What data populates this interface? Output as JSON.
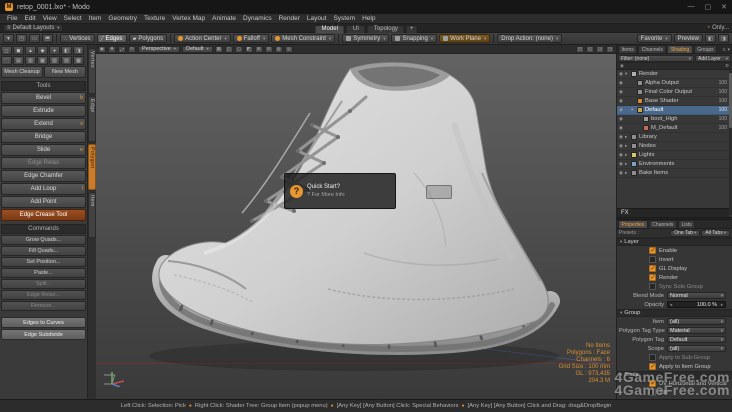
{
  "window": {
    "title": "retop_0001.lxo* - Modo",
    "icon_letter": "M",
    "controls": {
      "minimize": "—",
      "maximize": "▢",
      "close": "✕"
    }
  },
  "glyphs": {
    "caret": "▾",
    "collapse": "▸",
    "expand": "▾",
    "bullet": "●",
    "menu": "≡",
    "clock": "◔",
    "eye": "◉",
    "gear": "⚙",
    "arrow_left": "◂",
    "arrow_right": "▸",
    "tooltip_mark": "?"
  },
  "colors": {
    "accent": "#e8962e",
    "selection": "#49688c"
  },
  "menu_bar": {
    "items": [
      "File",
      "Edit",
      "View",
      "Select",
      "Item",
      "Geometry",
      "Texture",
      "Vertex Map",
      "Animate",
      "Dynamics",
      "Render",
      "Layout",
      "System",
      "Help"
    ]
  },
  "layout_bar": {
    "layouts_label": "Default Layouts",
    "tabs": [
      "Model",
      "UI",
      "Topology"
    ],
    "active_tab": "Model",
    "add_tab": "+",
    "right_label": "Only..."
  },
  "toolbar": {
    "left_icons": [
      "▼",
      "◳",
      "▭",
      "⬒"
    ],
    "selection_modes": [
      {
        "label": "Vertices",
        "icon": "∴",
        "active": false
      },
      {
        "label": "Edges",
        "icon": "╱",
        "active": true
      },
      {
        "label": "Polygons",
        "icon": "▰",
        "active": false
      }
    ],
    "tool_dropdowns": [
      {
        "label": "Action Center"
      },
      {
        "label": "Falloff"
      },
      {
        "label": "Mesh Constraint"
      }
    ],
    "modifiers": [
      {
        "label": "Symmetry",
        "accent": false
      },
      {
        "label": "Snapping",
        "accent": false
      },
      {
        "label": "Work Plane",
        "accent": true
      }
    ],
    "drop_action_label": "Drop Action: (none)",
    "right_buttons": [
      {
        "label": "Favorite",
        "caret": true
      },
      {
        "label": "Preview",
        "caret": false
      }
    ],
    "right_icons": [
      "◧",
      "◨"
    ]
  },
  "viewport_bar": {
    "left_icons": [
      "◉",
      "✥",
      "⤢",
      "⟳"
    ],
    "camera": "Perspective",
    "shading": "Default",
    "mid_icons": [
      "▦",
      "◫",
      "◻",
      "◩",
      "⊞",
      "⊟",
      "◍",
      "◎"
    ],
    "right_icons": [
      "◰",
      "◱",
      "◲",
      "◳"
    ]
  },
  "left_panel": {
    "icon_row1": [
      "◻",
      "◼",
      "▲",
      "◆",
      "●",
      "◧",
      "◨"
    ],
    "icon_row2": [
      "⬚",
      "▤",
      "▥",
      "▦",
      "▧",
      "▨",
      "▩"
    ],
    "top_buttons": [
      {
        "label": "Mesh Cleanup"
      },
      {
        "label": "New Mesh"
      }
    ],
    "tools_header": "Tools",
    "tools": [
      {
        "label": "Bevel",
        "shortcut": "b"
      },
      {
        "label": "Extrude",
        "shortcut": ""
      },
      {
        "label": "Extend",
        "shortcut": "x"
      },
      {
        "label": "Bridge",
        "shortcut": ""
      },
      {
        "label": "Slide",
        "shortcut": "e"
      },
      {
        "label": "Edge Relax",
        "shortcut": "",
        "dim": true
      },
      {
        "label": "Edge Chamfer",
        "shortcut": ""
      },
      {
        "label": "Add Loop",
        "shortcut": "l"
      },
      {
        "label": "Add Point",
        "shortcut": ""
      },
      {
        "label": "Edge Crease Tool",
        "shortcut": "",
        "active": true
      }
    ],
    "commands_header": "Commands",
    "commands": [
      {
        "label": "Grow Quads..."
      },
      {
        "label": "Fill Quads..."
      },
      {
        "label": "Set Position..."
      },
      {
        "label": "Paste..."
      },
      {
        "label": "Split...",
        "dim": true
      },
      {
        "label": "Edge Relax...",
        "dim": true
      },
      {
        "label": "Remove...",
        "dim": true
      }
    ],
    "bottom_buttons": [
      {
        "label": "Edges to Curves"
      },
      {
        "label": "Edge Subdivide"
      }
    ],
    "side_tabs": [
      "Vertex",
      "Edge",
      "Polygon",
      "Item"
    ],
    "side_active": "Polygon"
  },
  "viewport": {
    "tooltip": {
      "line1": "Quick Start?",
      "line2": "? For More Info"
    },
    "stats": [
      "No Items",
      "Polygons : Face",
      "Channels : 6",
      "Grid Size : 100 mm",
      "GL : 973,435",
      "204.3 M"
    ],
    "watermark": "4GameFree.com"
  },
  "shader_panel": {
    "tabs": [
      {
        "label": "Items",
        "active": false
      },
      {
        "label": "Channels",
        "active": false
      },
      {
        "label": "Shading",
        "active": true
      },
      {
        "label": "Groups",
        "active": false
      }
    ],
    "filter_label": "Filter: (none)",
    "add_layer_label": "Add Layer",
    "fx_label": "FX",
    "rows": [
      {
        "name": "Render",
        "depth": 0,
        "exp": "▾",
        "dot": "#b0b0b0",
        "value": ""
      },
      {
        "name": "Alpha Output",
        "depth": 1,
        "exp": "",
        "dot": "#8f8f8f",
        "value": "100"
      },
      {
        "name": "Final Color Output",
        "depth": 1,
        "exp": "",
        "dot": "#8f8f8f",
        "value": "100"
      },
      {
        "name": "Base Shader",
        "depth": 1,
        "exp": "",
        "dot": "#d28a2e",
        "value": "100"
      },
      {
        "name": "Default",
        "depth": 1,
        "exp": "▾",
        "dot": "#c9a54a",
        "value": "100",
        "selected": true
      },
      {
        "name": "boot_High",
        "depth": 2,
        "exp": "",
        "dot": "#9a9a9a",
        "value": "100"
      },
      {
        "name": "M_Default",
        "depth": 2,
        "exp": "",
        "dot": "#c66a5a",
        "value": "100"
      },
      {
        "name": "Library",
        "depth": 0,
        "exp": "▸",
        "dot": "#8f8f8f",
        "value": ""
      },
      {
        "name": "Nodes",
        "depth": 0,
        "exp": "▸",
        "dot": "#8f8f8f",
        "value": ""
      },
      {
        "name": "Lights",
        "depth": 0,
        "exp": "▸",
        "dot": "#d8c66a",
        "value": ""
      },
      {
        "name": "Environments",
        "depth": 0,
        "exp": "▸",
        "dot": "#7fa3c6",
        "value": ""
      },
      {
        "name": "Bake Items",
        "depth": 0,
        "exp": "▸",
        "dot": "#8f8f8f",
        "value": ""
      }
    ]
  },
  "properties_panel": {
    "tabs": [
      {
        "label": "Properties",
        "active": true
      },
      {
        "label": "Channels",
        "active": false
      },
      {
        "label": "Lists",
        "active": false
      }
    ],
    "presets_label": "Presets :",
    "preset_buttons": [
      "One Tab",
      "All Tabs"
    ],
    "sections": [
      {
        "title": "Layer",
        "rows": [
          {
            "type": "check",
            "label": "Enable",
            "checked": true
          },
          {
            "type": "check",
            "label": "Invert",
            "checked": false
          },
          {
            "type": "check",
            "label": "GL Display",
            "checked": true
          },
          {
            "type": "check",
            "label": "Render",
            "checked": true
          },
          {
            "type": "check",
            "label": "Sync Solo Group",
            "checked": false,
            "dim": true
          },
          {
            "type": "dropdown",
            "label": "Blend Mode",
            "value": "Normal"
          },
          {
            "type": "number",
            "label": "Opacity",
            "value": "100.0 %"
          }
        ]
      },
      {
        "title": "Group",
        "rows": [
          {
            "type": "dropdown",
            "label": "Item",
            "value": "(all)"
          },
          {
            "type": "dropdown",
            "label": "Polygon Tag Type",
            "value": "Material"
          },
          {
            "type": "dropdown",
            "label": "Polygon Tag",
            "value": "Default"
          },
          {
            "type": "dropdown",
            "label": "Scope",
            "value": "(all)"
          },
          {
            "type": "check",
            "label": "Apply to Sub-Group",
            "checked": false,
            "dim": true
          },
          {
            "type": "check",
            "label": "Apply to Item Group",
            "checked": true
          }
        ]
      },
      {
        "title": "Scale",
        "rows": [
          {
            "type": "check",
            "label": "UV Horizontal and Vertical",
            "checked": true
          },
          {
            "type": "check",
            "label": "Tile",
            "checked": false
          }
        ]
      }
    ]
  },
  "status_bar": {
    "segments": [
      "Left Click: Selection: Pick",
      "Right Click: Shader Tree: Group Item (popup menu)",
      "[Any Key] [Any Button] Click: Special Behaviors",
      "[Any Key] [Any Button] Click and Drag: drag&DropBegin"
    ]
  }
}
